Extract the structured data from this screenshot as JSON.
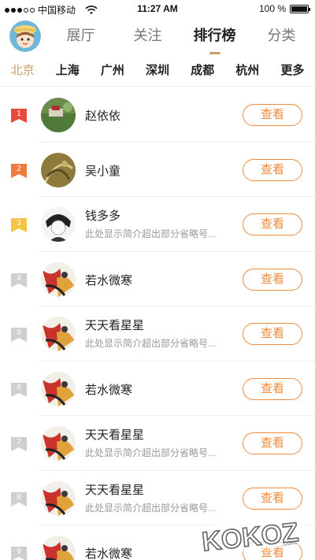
{
  "status_bar": {
    "carrier": "中国移动",
    "time": "11:27 AM",
    "battery_text": "100 %",
    "battery_level": 1.0
  },
  "nav": {
    "tabs": [
      "展厅",
      "关注",
      "排行榜",
      "分类"
    ],
    "active_tab": 2
  },
  "cities": {
    "items": [
      "北京",
      "上海",
      "广州",
      "深圳",
      "成都",
      "杭州",
      "更多"
    ],
    "active": 0
  },
  "rank_list": [
    {
      "rank": "1",
      "name": "赵依依",
      "desc": "",
      "button": "查看",
      "flag_color": "#e8493a"
    },
    {
      "rank": "2",
      "name": "吴小童",
      "desc": "",
      "button": "查看",
      "flag_color": "#f07a3c"
    },
    {
      "rank": "3",
      "name": "钱多多",
      "desc": "此处显示简介超出部分省略号...",
      "button": "查看",
      "flag_color": "#f5c445"
    },
    {
      "rank": "4",
      "name": "若水微寒",
      "desc": "",
      "button": "查看",
      "flag_color": "#cfcfcf"
    },
    {
      "rank": "5",
      "name": "天天看星星",
      "desc": "此处显示简介超出部分省略号...",
      "button": "查看",
      "flag_color": "#cfcfcf"
    },
    {
      "rank": "6",
      "name": "若水微寒",
      "desc": "",
      "button": "查看",
      "flag_color": "#cfcfcf"
    },
    {
      "rank": "7",
      "name": "天天看星星",
      "desc": "此处显示简介超出部分省略号...",
      "button": "查看",
      "flag_color": "#cfcfcf"
    },
    {
      "rank": "8",
      "name": "天天看星星",
      "desc": "此处显示简介超出部分省略号...",
      "button": "查看",
      "flag_color": "#cfcfcf"
    },
    {
      "rank": "9",
      "name": "若水微寒",
      "desc": "",
      "button": "查看",
      "flag_color": "#cfcfcf"
    }
  ],
  "watermark": {
    "text": "KOKOZ.com"
  },
  "colors": {
    "accent": "#c9a06a",
    "button": "#f08a3a"
  }
}
